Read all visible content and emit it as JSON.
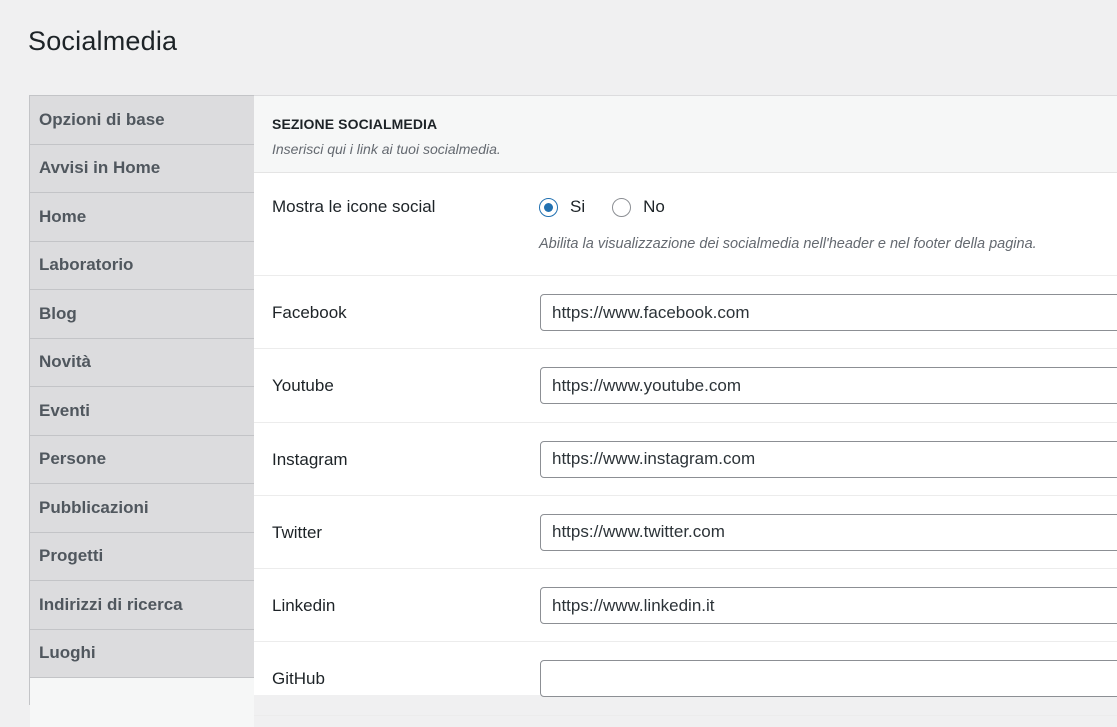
{
  "page": {
    "title": "Socialmedia"
  },
  "sidebar": {
    "items": [
      {
        "label": "Opzioni di base"
      },
      {
        "label": "Avvisi in Home"
      },
      {
        "label": "Home"
      },
      {
        "label": "Laboratorio"
      },
      {
        "label": "Blog"
      },
      {
        "label": "Novità"
      },
      {
        "label": "Eventi"
      },
      {
        "label": "Persone"
      },
      {
        "label": "Pubblicazioni"
      },
      {
        "label": "Progetti"
      },
      {
        "label": "Indirizzi di ricerca"
      },
      {
        "label": "Luoghi"
      }
    ]
  },
  "section": {
    "title": "SEZIONE SOCIALMEDIA",
    "description": "Inserisci qui i link ai tuoi socialmedia."
  },
  "show_icons": {
    "label": "Mostra le icone social",
    "options": [
      {
        "label": "Si",
        "checked": true
      },
      {
        "label": "No",
        "checked": false
      }
    ],
    "help": "Abilita la visualizzazione dei socialmedia nell'header e nel footer della pagina."
  },
  "fields": [
    {
      "label": "Facebook",
      "value": "https://www.facebook.com"
    },
    {
      "label": "Youtube",
      "value": "https://www.youtube.com"
    },
    {
      "label": "Instagram",
      "value": "https://www.instagram.com"
    },
    {
      "label": "Twitter",
      "value": "https://www.twitter.com"
    },
    {
      "label": "Linkedin",
      "value": "https://www.linkedin.it"
    },
    {
      "label": "GitHub",
      "value": ""
    }
  ],
  "colors": {
    "accent": "#2271b1",
    "sidebar_bg": "#dcdcde",
    "page_bg": "#f0f0f1"
  }
}
